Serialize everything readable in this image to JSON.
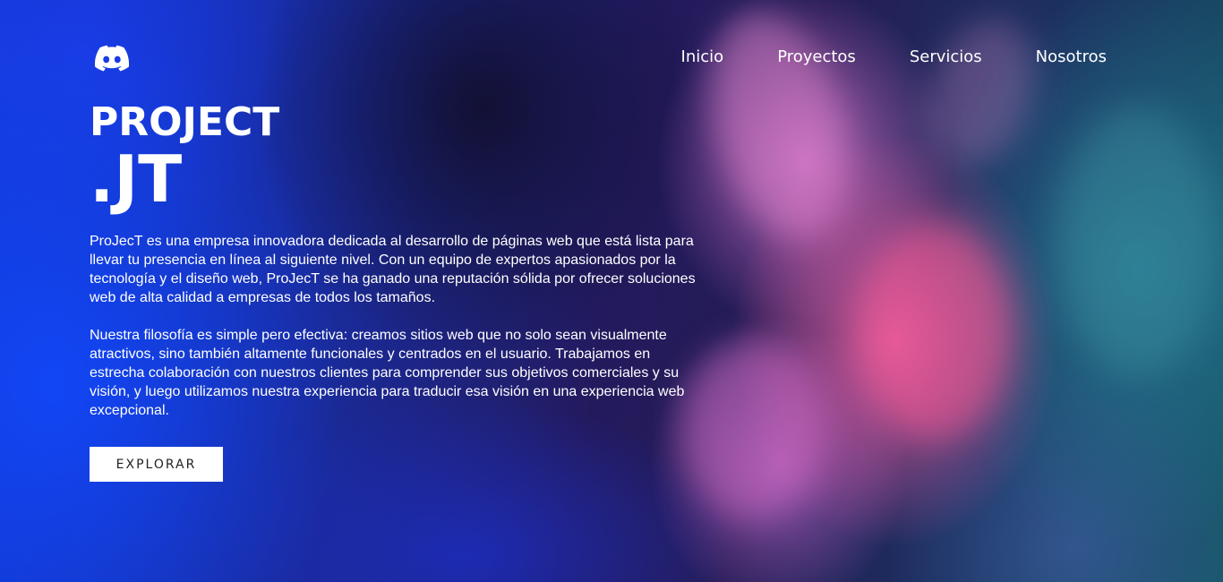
{
  "brand": {
    "logo_icon": "discord-icon"
  },
  "nav": {
    "items": [
      {
        "label": "Inicio"
      },
      {
        "label": "Proyectos"
      },
      {
        "label": "Servicios"
      },
      {
        "label": "Nosotros"
      }
    ]
  },
  "hero": {
    "title_line1": "PROJECT",
    "title_line2": ".JT",
    "paragraph1": "ProJecT es una empresa innovadora dedicada al desarrollo de páginas web que está lista para llevar tu presencia en línea al siguiente nivel. Con un equipo de expertos apasionados por la tecnología y el diseño web, ProJecT se ha ganado una reputación sólida por ofrecer soluciones web de alta calidad a empresas de todos los tamaños.",
    "paragraph2": "Nuestra filosofía es simple pero efectiva: creamos sitios web que no solo sean visualmente atractivos, sino también altamente funcionales y centrados en el usuario. Trabajamos en estrecha colaboración con nuestros clientes para comprender sus objetivos comerciales y su visión, y luego utilizamos nuestra experiencia para traducir esa visión en una experiencia web excepcional.",
    "button_label": "EXPLORAR"
  },
  "colors": {
    "text": "#ffffff",
    "button_bg": "#ffffff",
    "button_text": "#222222",
    "smoke_pink": "#e45c9e",
    "smoke_blue": "#1246f5",
    "smoke_teal": "#287d96"
  }
}
